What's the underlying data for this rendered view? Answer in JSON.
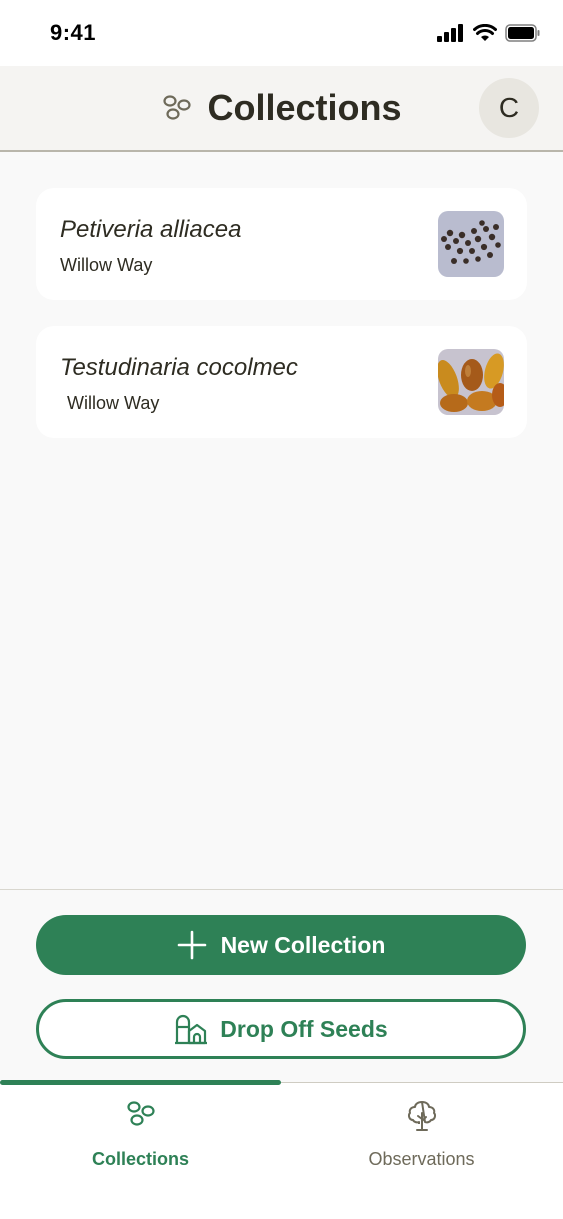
{
  "status_bar": {
    "time": "9:41"
  },
  "header": {
    "title": "Collections",
    "avatar_initial": "C"
  },
  "collections": [
    {
      "name": "Petiveria alliacea",
      "location": "Willow Way"
    },
    {
      "name": "Testudinaria cocolmec",
      "location": "Willow Way"
    }
  ],
  "actions": {
    "new_collection": "New Collection",
    "drop_off": "Drop Off Seeds"
  },
  "tabs": [
    {
      "label": "Collections",
      "active": true
    },
    {
      "label": "Observations",
      "active": false
    }
  ],
  "colors": {
    "accent": "#2e8156",
    "text": "#2e2c22",
    "background": "#f9f9f9"
  }
}
